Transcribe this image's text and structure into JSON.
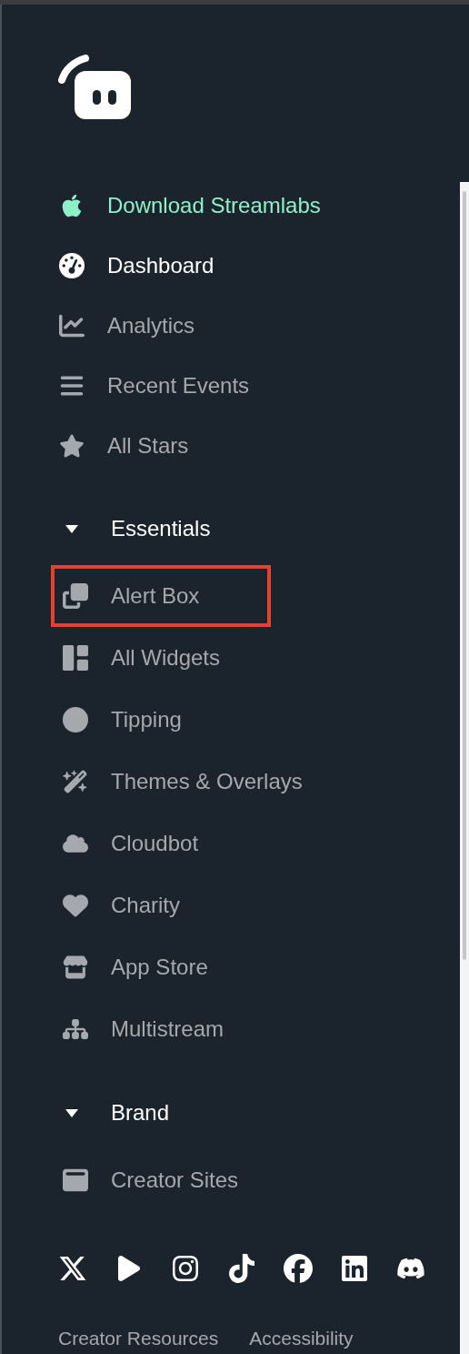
{
  "nav": [
    {
      "label": "Download Streamlabs",
      "kind": "promo",
      "selected": false
    },
    {
      "label": "Dashboard",
      "kind": "link",
      "selected": true
    },
    {
      "label": "Analytics",
      "kind": "link",
      "selected": false
    },
    {
      "label": "Recent Events",
      "kind": "link",
      "selected": false
    },
    {
      "label": "All Stars",
      "kind": "link",
      "selected": false
    }
  ],
  "sections": [
    {
      "label": "Essentials",
      "expanded": true,
      "items": [
        {
          "label": "Alert Box",
          "selected": false,
          "annotated": true
        },
        {
          "label": "All Widgets",
          "selected": false,
          "annotated": false
        },
        {
          "label": "Tipping",
          "selected": false,
          "annotated": false
        },
        {
          "label": "Themes & Overlays",
          "selected": false,
          "annotated": false
        },
        {
          "label": "Cloudbot",
          "selected": false,
          "annotated": false
        },
        {
          "label": "Charity",
          "selected": false,
          "annotated": false
        },
        {
          "label": "App Store",
          "selected": false,
          "annotated": false
        },
        {
          "label": "Multistream",
          "selected": false,
          "annotated": false
        }
      ]
    },
    {
      "label": "Brand",
      "expanded": true,
      "items": [
        {
          "label": "Creator Sites",
          "selected": false,
          "annotated": false
        }
      ]
    }
  ],
  "footer_links": [
    "Creator Resources",
    "Accessibility"
  ]
}
